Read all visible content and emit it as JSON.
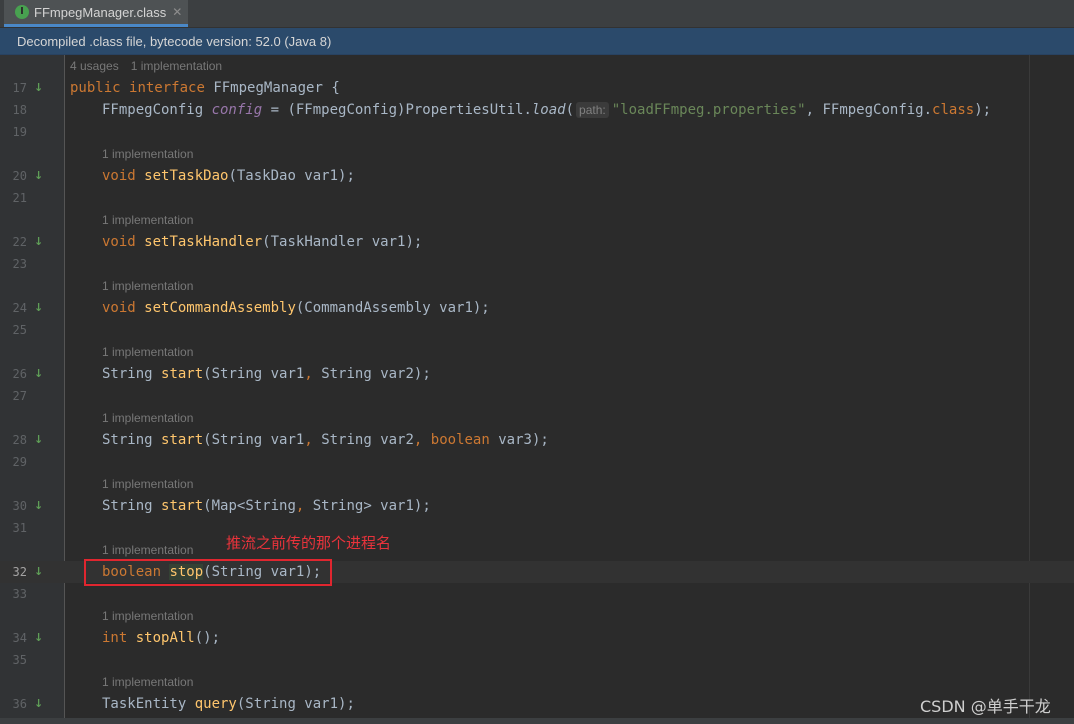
{
  "tab": {
    "icon_letter": "I",
    "label": "FFmpegManager.class",
    "close": "✕"
  },
  "infobar": {
    "text": "Decompiled .class file, bytecode version: 52.0 (Java 8)"
  },
  "hints": {
    "usages": "4 usages",
    "impl": "1 implementation"
  },
  "lines": {
    "l17": "17",
    "l18": "18",
    "l19": "19",
    "l20": "20",
    "l21": "21",
    "l22": "22",
    "l23": "23",
    "l24": "24",
    "l25": "25",
    "l26": "26",
    "l27": "27",
    "l28": "28",
    "l29": "29",
    "l30": "30",
    "l31": "31",
    "l32": "32",
    "l33": "33",
    "l34": "34",
    "l35": "35",
    "l36": "36"
  },
  "code": {
    "c17": {
      "kw1": "public",
      "kw2": "interface",
      "name": "FFmpegManager",
      "brace": " {"
    },
    "c18": {
      "type": "FFmpegConfig ",
      "field": "config",
      "eq": " = (FFmpegConfig)PropertiesUtil.",
      "call": "load",
      "open": "(",
      "hint": "path:",
      "str": "\"loadFFmpeg.properties\"",
      "mid": ", FFmpegConfig.",
      "kw": "class",
      "end": ");"
    },
    "c20": {
      "kw": "void",
      "fn": "setTaskDao",
      "args": "(TaskDao var1);"
    },
    "c22": {
      "kw": "void",
      "fn": "setTaskHandler",
      "args": "(TaskHandler var1);"
    },
    "c24": {
      "kw": "void",
      "fn": "setCommandAssembly",
      "args": "(CommandAssembly var1);"
    },
    "c26": {
      "type": "String ",
      "fn": "start",
      "a1": "(String var1",
      "comma": ",",
      "a2": " String var2);"
    },
    "c28": {
      "type": "String ",
      "fn": "start",
      "a1": "(String var1",
      "comma1": ",",
      "a2": " String var2",
      "comma2": ",",
      "kw": " boolean",
      "a3": " var3);"
    },
    "c30": {
      "type": "String ",
      "fn": "start",
      "a1": "(Map<String",
      "comma": ",",
      "a2": " String> var1);"
    },
    "c32": {
      "kw": "boolean",
      "fn": "stop",
      "args": "(String var1);"
    },
    "c34": {
      "kw": "int",
      "fn": "stopAll",
      "args": "();"
    },
    "c36": {
      "type": "TaskEntity ",
      "fn": "query",
      "args": "(String var1);"
    }
  },
  "gutter_icon": "↓",
  "annotation": {
    "text": "推流之前传的那个进程名"
  },
  "watermark": "CSDN @单手干龙",
  "colors": {
    "keyword": "#cc7832",
    "method": "#ffc66d",
    "field": "#9876aa",
    "string": "#6a8759",
    "annotation": "#e0262f",
    "infobar": "#2b4a6b"
  }
}
